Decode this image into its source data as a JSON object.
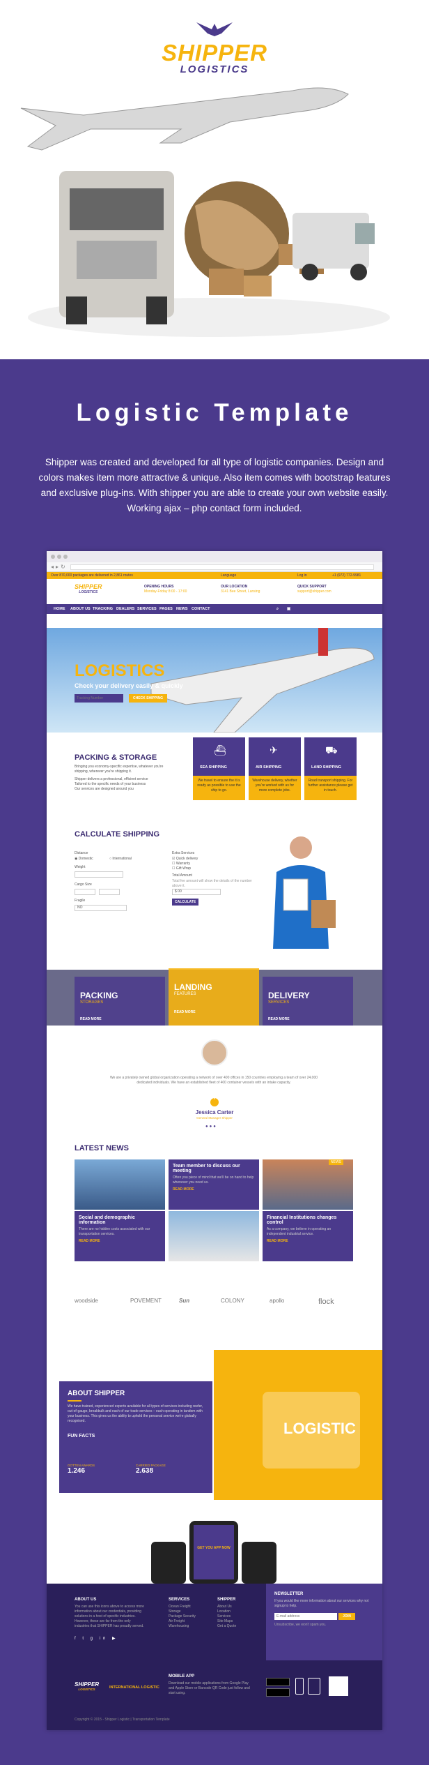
{
  "hero": {
    "logo_top": "SHIPPER",
    "logo_bottom": "LOGISTICS"
  },
  "intro": {
    "title": "Logistic Template",
    "text": "Shipper was created and developed for all type of logistic companies. Design and colors makes item more attractive & unique. Also item comes with bootstrap features and exclusive plug-ins. With shipper you are able to create your own website easily. Working ajax – php contact form included."
  },
  "site": {
    "topbar_left": "Over 870,000 packages are delivered in 2,861 routes",
    "topbar_lang": "Language",
    "topbar_login": "Log in",
    "topbar_phone": "+1 (972) 772-9981",
    "logo_top": "SHIPPER",
    "logo_bottom": "LOGISTICS",
    "header_items": [
      {
        "title": "OPENING HOURS",
        "sub": "Monday-Friday 8:00 - 17:00"
      },
      {
        "title": "OUR LOCATION",
        "sub": "3141 Bee Street, Lansing"
      },
      {
        "title": "QUICK SUPPORT",
        "sub": "support@shipper.com"
      }
    ],
    "nav": [
      "HOME",
      "ABOUT US",
      "TRACKING",
      "DEALERS",
      "SERVICES",
      "PAGES",
      "NEWS",
      "CONTACT"
    ],
    "banner_title": "LOGISTICS",
    "banner_sub": "Check your delivery easily & quickly",
    "track_placeholder": "Tracking Number",
    "track_button": "CHECK SHIPPING",
    "packing_title": "PACKING & STORAGE",
    "packing_text": "Bringing you economy-specific expertise, whatever you're shipping, wherever you're shipping it.",
    "packing_bullets": [
      "Shipper delivers a professional, efficient service",
      "Tailored to the specific needs of your business",
      "Our services are designed around you"
    ],
    "services": [
      {
        "title": "SEA SHIPPING",
        "text": "We travel to ensure the it is ready as possible to use the ship to go."
      },
      {
        "title": "AIR SHIPPING",
        "text": "Warehouse delivery, whether you're worked with us for more complete jobs."
      },
      {
        "title": "LAND SHIPPING",
        "text": "Road transport shipping. For further assistance please get in touch."
      }
    ],
    "calc_title": "CALCULATE SHIPPING",
    "calc_labels": {
      "distance": "Distance",
      "domestic": "Domestic",
      "international": "International",
      "weight": "Weight",
      "cargo": "Cargo Size",
      "fragile": "Fragile",
      "fragile_value": "NO",
      "extra": "Extra Services",
      "extra_opts": [
        "Quick delivery",
        "Warranty",
        "Gift Wrap"
      ],
      "total": "Total Amount",
      "note": "Total fee amount will show the details of the number above it.",
      "total_value": "$ 00",
      "button": "CALCULATE"
    },
    "features": [
      {
        "title": "PACKING",
        "sub": "STORAGES",
        "link": "READ MORE"
      },
      {
        "title": "LANDING",
        "sub": "FEATURES",
        "link": "READ MORE"
      },
      {
        "title": "DELIVERY",
        "sub": "SERVICES",
        "link": "READ MORE"
      }
    ],
    "testimonial_text": "We are a privately owned global organization operating a network of over 400 offices in 150 countries employing a team of over 24,000 dedicated individuals. We have an established fleet of 400 container vessels with an intake capacity.",
    "testimonial_name": "Jessica Carter",
    "testimonial_role": "General Manager Shipper",
    "news_title": "LATEST NEWS",
    "news": [
      {
        "title": "Team member to discuss our meeting",
        "text": "Often you piece of mind that we'll be on hand to help whenever you need us.",
        "link": "READ MORE",
        "badge": "NEWS"
      },
      {
        "title": "Social and demographic information",
        "text": "There are no hidden costs associated with our transportation services.",
        "link": "READ MORE",
        "badge": "NEWS"
      },
      {
        "title": "Financial Institutions changes control",
        "text": "As a company, we believe in operating an independent industrial service.",
        "link": "READ MORE",
        "badge": "NEWS"
      }
    ],
    "partners": [
      "woodside",
      "POVEMENT",
      "Sun",
      "COLONY",
      "apollo",
      "flock"
    ],
    "about_title": "ABOUT SHIPPER",
    "about_text": "We have trained, experienced experts available for all types of services including reefer, out-of-gauge, breakbulk and each of our trade services – each operating in tandem with your business. This gives us the ability to uphold the personal service we're globally recognised.",
    "funfacts_title": "FUN FACTS",
    "funfacts": [
      {
        "label": "GOTTEN AWARDS",
        "value": "1.246"
      },
      {
        "label": "CARRIED PACKAGE",
        "value": "2.638"
      }
    ],
    "logistic_word": "LOGISTIC",
    "app_cta": "GET YOU APP NOW",
    "footer": {
      "about_title": "ABOUT US",
      "about_text": "You can use this icons above to access more information about our credentials, providing solutions in a host of specific industries. However, these are far from the only industries that SHIPPER has proudly served.",
      "services_title": "SERVICES",
      "services": [
        "Ocean Freight",
        "Storage",
        "Package Security",
        "Air Freight",
        "Warehousing"
      ],
      "shipper_title": "SHIPPER",
      "shipper_links": [
        "About Us",
        "Location",
        "Services",
        "Site Maps",
        "Get a Quote"
      ],
      "newsletter_title": "NEWSLETTER",
      "newsletter_text": "If you would like more information about our services why not signup to help.",
      "newsletter_placeholder": "E-mail address",
      "newsletter_button": "JOIN",
      "newsletter_note": "Unsubscribe, we won't spam you.",
      "brand_line": "INTERNATIONAL LOGISTIC",
      "mobile_title": "MOBILE APP",
      "mobile_text": "Download our mobile applications from Google Play and Apple Store or Barcode QR Code just follow and start using.",
      "copyright": "Copyright © 2015 - Shipper Logistic | Transportation Template"
    }
  },
  "colors": {
    "purple": "#4b3a8c",
    "yellow": "#f6b40e",
    "dark": "#2a1f5a"
  }
}
